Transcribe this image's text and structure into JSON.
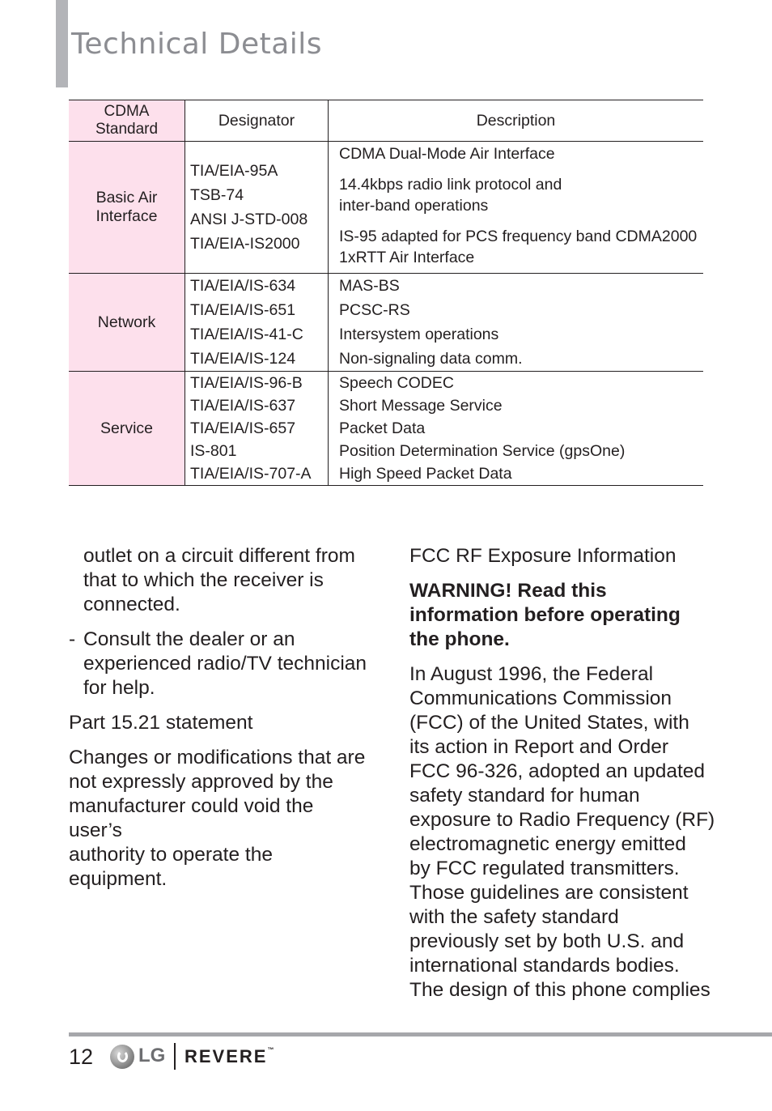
{
  "header": {
    "title": "Technical Details"
  },
  "table": {
    "headers": [
      "CDMA Standard",
      "Designator",
      "Description"
    ],
    "header_std_lines": [
      "CDMA",
      "Standard"
    ],
    "rows": [
      {
        "category_lines": [
          "Basic Air",
          "Interface"
        ],
        "designators": [
          "TIA/EIA-95A",
          "TSB-74",
          "ANSI J-STD-008",
          "TIA/EIA-IS2000"
        ],
        "descriptions": [
          [
            "CDMA Dual-Mode Air Interface"
          ],
          [
            "14.4kbps radio link protocol and",
            "inter-band operations"
          ],
          [
            "IS-95 adapted for PCS frequency band CDMA2000",
            "1xRTT Air Interface"
          ]
        ]
      },
      {
        "category_lines": [
          "Network"
        ],
        "designators": [
          "TIA/EIA/IS-634",
          "TIA/EIA/IS-651",
          "TIA/EIA/IS-41-C",
          "TIA/EIA/IS-124"
        ],
        "descriptions": [
          "MAS-BS",
          "PCSC-RS",
          "Intersystem operations",
          "Non-signaling data comm."
        ]
      },
      {
        "category_lines": [
          "Service"
        ],
        "designators": [
          "TIA/EIA/IS-96-B",
          "TIA/EIA/IS-637",
          "TIA/EIA/IS-657",
          "IS-801",
          "TIA/EIA/IS-707-A"
        ],
        "descriptions": [
          "Speech CODEC",
          "Short Message Service",
          "Packet Data",
          "Position Determination Service (gpsOne)",
          "High Speed Packet Data"
        ]
      }
    ]
  },
  "left_column": {
    "continuation_lines": [
      "outlet on a circuit different from",
      "that to which the receiver is",
      "connected."
    ],
    "bullet_marker": "-",
    "bullet_lines": [
      "Consult the dealer or an",
      "experienced radio/TV technician",
      "for help."
    ],
    "section_heading": "Part 15.21 statement",
    "section_body_lines": [
      "Changes or modifications that are",
      "not expressly approved by the",
      "manufacturer could void the user’s",
      "authority to operate the",
      "equipment."
    ]
  },
  "right_column": {
    "section_heading": "FCC RF Exposure Information",
    "warning_lines": [
      "WARNING! Read this",
      "information before operating",
      "the phone."
    ],
    "body_lines": [
      "In August 1996, the Federal",
      "Communications Commission",
      "(FCC) of the United States, with",
      "its action in Report and Order",
      "FCC 96-326, adopted an updated",
      "safety standard for human",
      "exposure to Radio Frequency (RF)",
      "electromagnetic energy emitted",
      "by FCC regulated transmitters.",
      "Those guidelines are consistent",
      "with the safety standard",
      "previously set by both U.S. and",
      "international standards bodies.",
      "The design of this phone complies"
    ]
  },
  "footer": {
    "page_number": "12",
    "logo_icon": "lg-logo-icon",
    "brand_logo_text": "LG",
    "product_name": "REVERE",
    "trademark": "™"
  }
}
